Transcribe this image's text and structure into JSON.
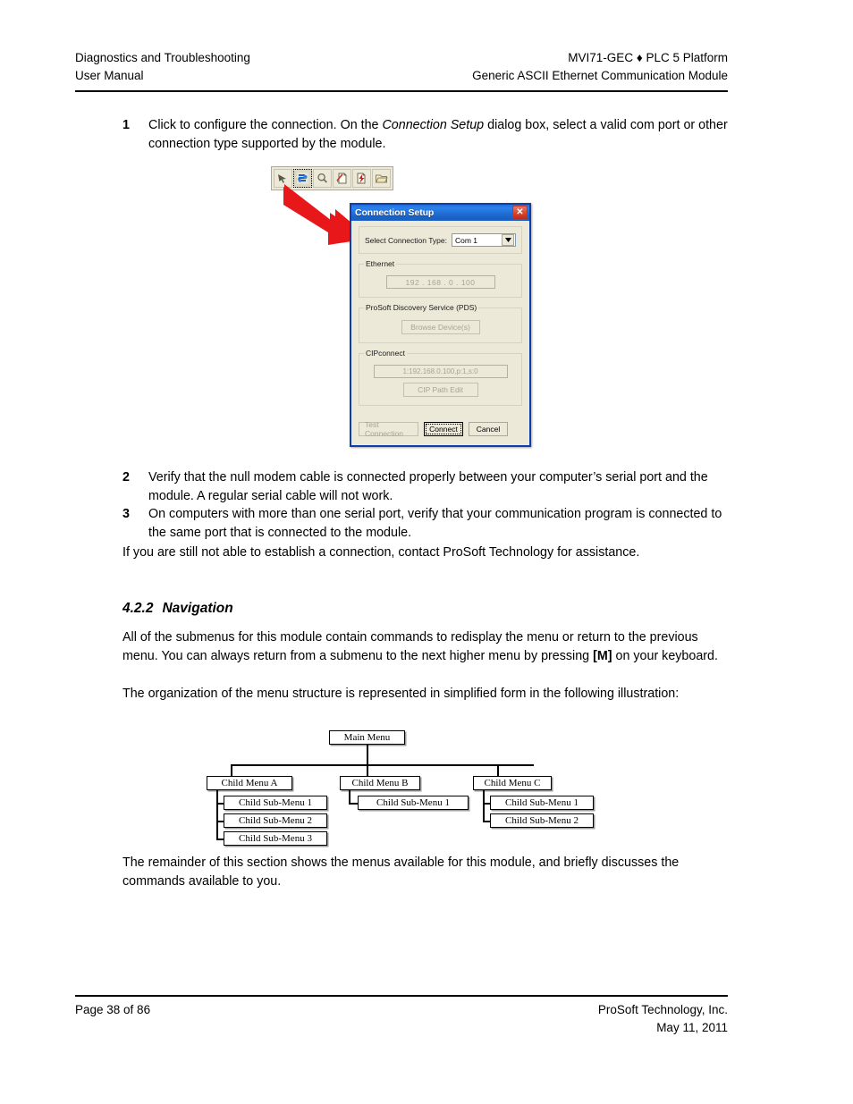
{
  "header": {
    "left_line1": "Diagnostics and Troubleshooting",
    "left_line2": "User Manual",
    "right_line1": "MVI71-GEC ♦ PLC 5 Platform",
    "right_line2": "Generic ASCII Ethernet Communication Module"
  },
  "steps": [
    {
      "num": "1",
      "text_before": "Click to configure the connection. On the ",
      "emphasis": "Connection Setup",
      "text_after": " dialog box, select a valid com port or other connection type supported by the module."
    },
    {
      "num": "2",
      "text": "Verify that the null modem cable is connected properly between your computer’s serial port and the module. A regular serial cable will not work."
    },
    {
      "num": "3",
      "text": "On computers with more than one serial port, verify that your communication program is connected to the same port that is connected to the module."
    }
  ],
  "paragraphs": {
    "after_steps": "If you are still not able to establish a connection, contact ProSoft Technology for assistance.",
    "nav_p1_before": "All of the submenus for this module contain commands to redisplay the menu or return to the previous menu. You can always return from a submenu to the next higher menu by pressing ",
    "nav_p1_key": "[M]",
    "nav_p1_after": " on your keyboard.",
    "nav_p2": "The organization of the menu structure is represented in simplified form in the following illustration:",
    "closing": "The remainder of this section shows the menus available for this module, and briefly discusses the commands available to you."
  },
  "section": {
    "number": "4.2.2",
    "title": "Navigation"
  },
  "figure": {
    "toolbar": {
      "buttons": [
        {
          "icon": "cursor-arrow-icon",
          "selected": false
        },
        {
          "icon": "connection-setup-icon",
          "selected": true
        },
        {
          "icon": "magnifier-icon",
          "selected": false
        },
        {
          "icon": "document-pencil-icon",
          "selected": false
        },
        {
          "icon": "document-lightning-icon",
          "selected": false
        },
        {
          "icon": "open-folder-icon",
          "selected": false
        }
      ]
    },
    "annotation": {
      "type": "red-arrow",
      "color": "#e8171a"
    },
    "dialog": {
      "title": "Connection Setup",
      "close_label": "✕",
      "title_bar_color": "#1f6fd4",
      "connection_type_label": "Select Connection Type:",
      "connection_type_value": "Com 1",
      "groups": [
        {
          "legend": "Ethernet",
          "ip_value": "192 . 168 .   0  . 100"
        },
        {
          "legend": "ProSoft Discovery Service (PDS)",
          "button": "Browse Device(s)"
        },
        {
          "legend": "CIPconnect",
          "path_value": "1:192.168.0.100,p:1,s:0",
          "button": "CIP Path Edit"
        }
      ],
      "buttons": {
        "test": "Test Connection",
        "connect": "Connect",
        "cancel": "Cancel"
      }
    }
  },
  "tree": {
    "root": "Main Menu",
    "children": [
      {
        "label": "Child Menu A",
        "subs": [
          "Child Sub-Menu 1",
          "Child Sub-Menu 2",
          "Child Sub-Menu 3"
        ]
      },
      {
        "label": "Child Menu B",
        "subs": [
          "Child Sub-Menu 1"
        ]
      },
      {
        "label": "Child Menu C",
        "subs": [
          "Child Sub-Menu 1",
          "Child Sub-Menu 2"
        ]
      }
    ]
  },
  "footer": {
    "left": "Page 38 of 86",
    "right_line1": "ProSoft Technology, Inc.",
    "right_line2": "May 11, 2011"
  }
}
